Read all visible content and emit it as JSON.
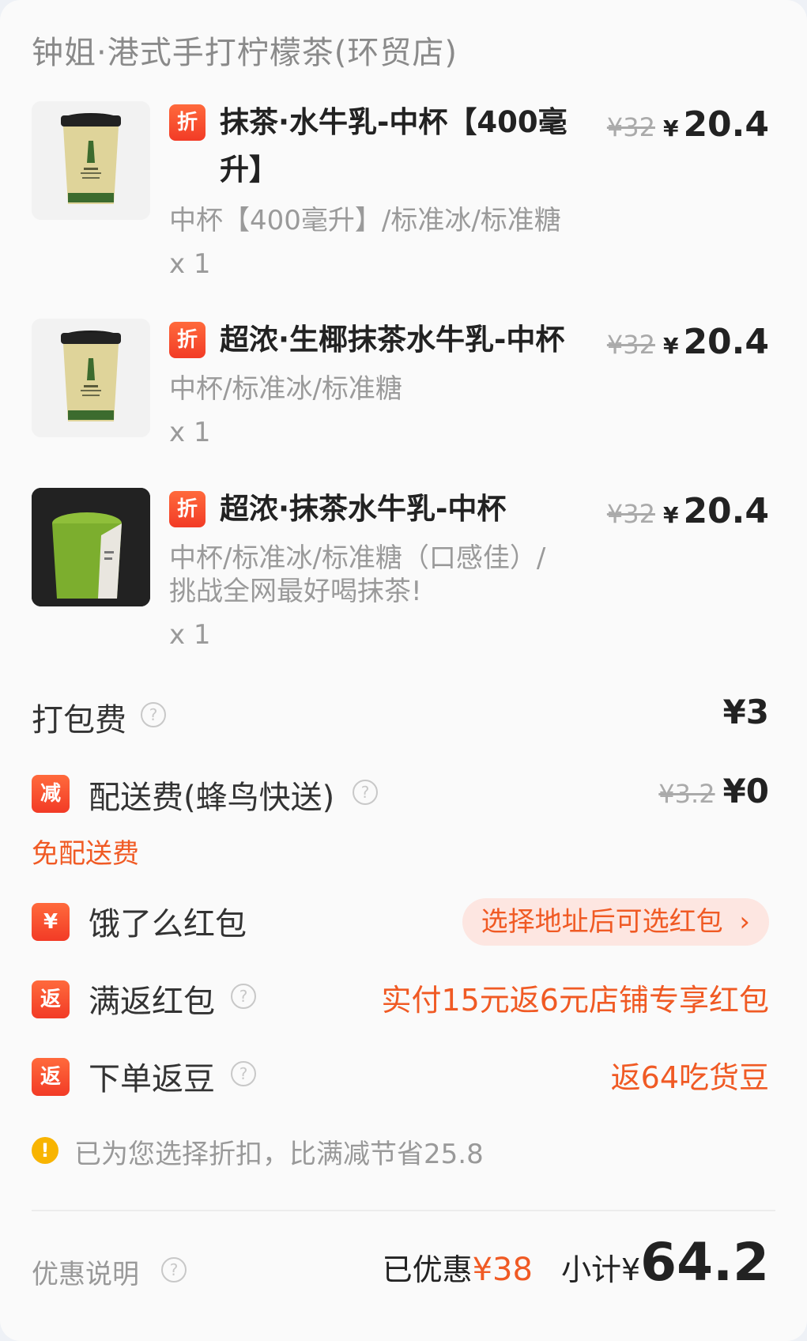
{
  "store": {
    "name": "钟姐·港式手打柠檬茶(环贸店)"
  },
  "items": [
    {
      "badge": "折",
      "name": "抹茶·水牛乳-中杯【400毫升】",
      "spec": "中杯【400毫升】/标准冰/标准糖",
      "qty": "x 1",
      "original_price": "¥32",
      "currency": "¥",
      "price": "20.4",
      "thumbnail": "matcha-cup-image"
    },
    {
      "badge": "折",
      "name": "超浓·生椰抹茶水牛乳-中杯",
      "spec": "中杯/标准冰/标准糖",
      "qty": "x 1",
      "original_price": "¥32",
      "currency": "¥",
      "price": "20.4",
      "thumbnail": "matcha-cup-image"
    },
    {
      "badge": "折",
      "name": "超浓·抹茶水牛乳-中杯",
      "spec": "中杯/标准冰/标准糖（口感佳）/挑战全网最好喝抹茶!",
      "qty": "x 1",
      "original_price": "¥32",
      "currency": "¥",
      "price": "20.4",
      "thumbnail": "green-drink-photo"
    }
  ],
  "packing": {
    "label": "打包费",
    "value": "¥3"
  },
  "delivery": {
    "badge": "减",
    "label": "配送费(蜂鸟快送)",
    "original": "¥3.2",
    "value": "¥0",
    "note": "免配送费"
  },
  "redpacket": {
    "badge": "¥",
    "label": "饿了么红包",
    "action": "选择地址后可选红包"
  },
  "cashback": {
    "badge": "返",
    "label": "满返红包",
    "value": "实付15元返6元店铺专享红包"
  },
  "beans": {
    "badge": "返",
    "label": "下单返豆",
    "value": "返64吃货豆"
  },
  "notice": {
    "text": "已为您选择折扣，比满减节省25.8"
  },
  "footer": {
    "discount_info": "优惠说明",
    "saved_label": "已优惠",
    "saved_value": "¥38",
    "subtotal_label": "小计¥",
    "subtotal_value": "64.2"
  },
  "colors": {
    "accent": "#f05a24",
    "badge": "#f23b26",
    "pill_bg": "#fde6e1"
  }
}
